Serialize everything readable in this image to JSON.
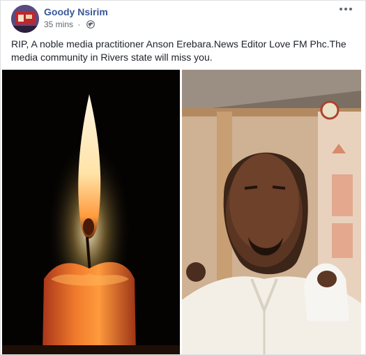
{
  "post": {
    "author": "Goody Nsirim",
    "timestamp": "35 mins",
    "privacy_icon": "globe-icon",
    "menu_icon": "more-options-icon",
    "text": "RIP, A noble media practitioner Anson Erebara.News Editor Love FM Phc.The media community in Rivers state will miss you.",
    "photos": [
      {
        "name": "candle-photo"
      },
      {
        "name": "man-portrait-photo"
      }
    ]
  },
  "colors": {
    "author_link": "#385898",
    "meta_text": "#616770",
    "body_text": "#1d2129",
    "border": "#dddfe2"
  }
}
